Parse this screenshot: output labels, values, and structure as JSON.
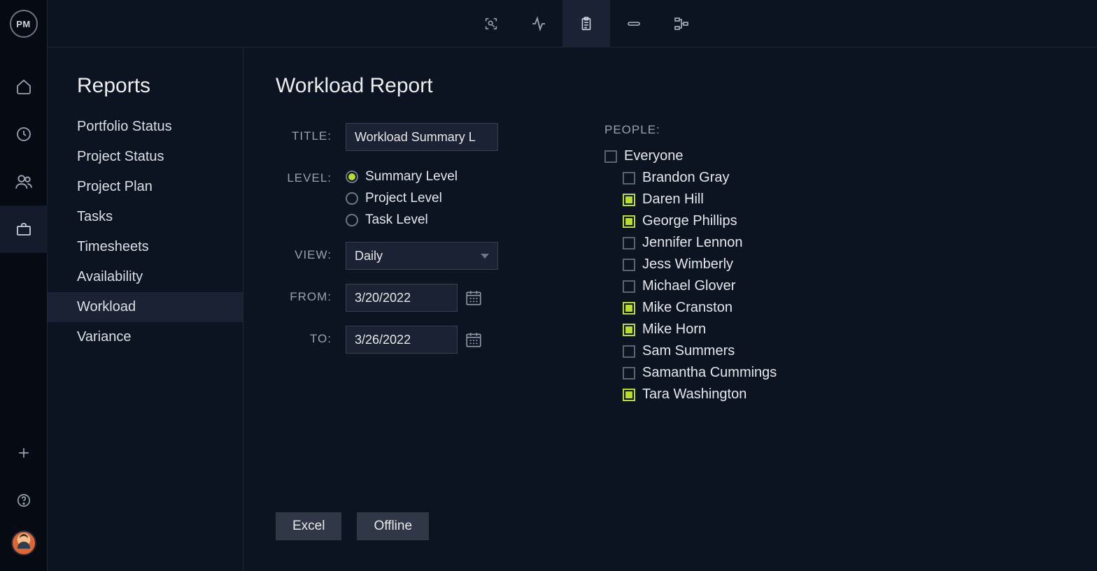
{
  "logo_text": "PM",
  "rail": {
    "items": [
      {
        "name": "home-icon",
        "active": false
      },
      {
        "name": "clock-icon",
        "active": false
      },
      {
        "name": "people-icon",
        "active": false
      },
      {
        "name": "briefcase-icon",
        "active": true
      }
    ],
    "bottom": [
      {
        "name": "plus-icon"
      },
      {
        "name": "help-icon"
      }
    ]
  },
  "topbar": {
    "items": [
      {
        "name": "scan-icon",
        "active": false
      },
      {
        "name": "activity-icon",
        "active": false
      },
      {
        "name": "clipboard-icon",
        "active": true
      },
      {
        "name": "link-icon",
        "active": false
      },
      {
        "name": "flow-icon",
        "active": false
      }
    ]
  },
  "sidebar": {
    "title": "Reports",
    "items": [
      {
        "label": "Portfolio Status",
        "active": false
      },
      {
        "label": "Project Status",
        "active": false
      },
      {
        "label": "Project Plan",
        "active": false
      },
      {
        "label": "Tasks",
        "active": false
      },
      {
        "label": "Timesheets",
        "active": false
      },
      {
        "label": "Availability",
        "active": false
      },
      {
        "label": "Workload",
        "active": true
      },
      {
        "label": "Variance",
        "active": false
      }
    ]
  },
  "panel": {
    "title": "Workload Report",
    "labels": {
      "title": "TITLE:",
      "level": "LEVEL:",
      "view": "VIEW:",
      "from": "FROM:",
      "to": "TO:",
      "people": "PEOPLE:"
    },
    "title_value": "Workload Summary L",
    "levels": [
      {
        "label": "Summary Level",
        "checked": true
      },
      {
        "label": "Project Level",
        "checked": false
      },
      {
        "label": "Task Level",
        "checked": false
      }
    ],
    "view_value": "Daily",
    "from_date": "3/20/2022",
    "to_date": "3/26/2022",
    "people": [
      {
        "label": "Everyone",
        "checked": false,
        "indent": false
      },
      {
        "label": "Brandon Gray",
        "checked": false,
        "indent": true
      },
      {
        "label": "Daren Hill",
        "checked": true,
        "indent": true
      },
      {
        "label": "George Phillips",
        "checked": true,
        "indent": true
      },
      {
        "label": "Jennifer Lennon",
        "checked": false,
        "indent": true
      },
      {
        "label": "Jess Wimberly",
        "checked": false,
        "indent": true
      },
      {
        "label": "Michael Glover",
        "checked": false,
        "indent": true
      },
      {
        "label": "Mike Cranston",
        "checked": true,
        "indent": true
      },
      {
        "label": "Mike Horn",
        "checked": true,
        "indent": true
      },
      {
        "label": "Sam Summers",
        "checked": false,
        "indent": true
      },
      {
        "label": "Samantha Cummings",
        "checked": false,
        "indent": true
      },
      {
        "label": "Tara Washington",
        "checked": true,
        "indent": true
      }
    ],
    "buttons": {
      "excel": "Excel",
      "offline": "Offline"
    }
  }
}
